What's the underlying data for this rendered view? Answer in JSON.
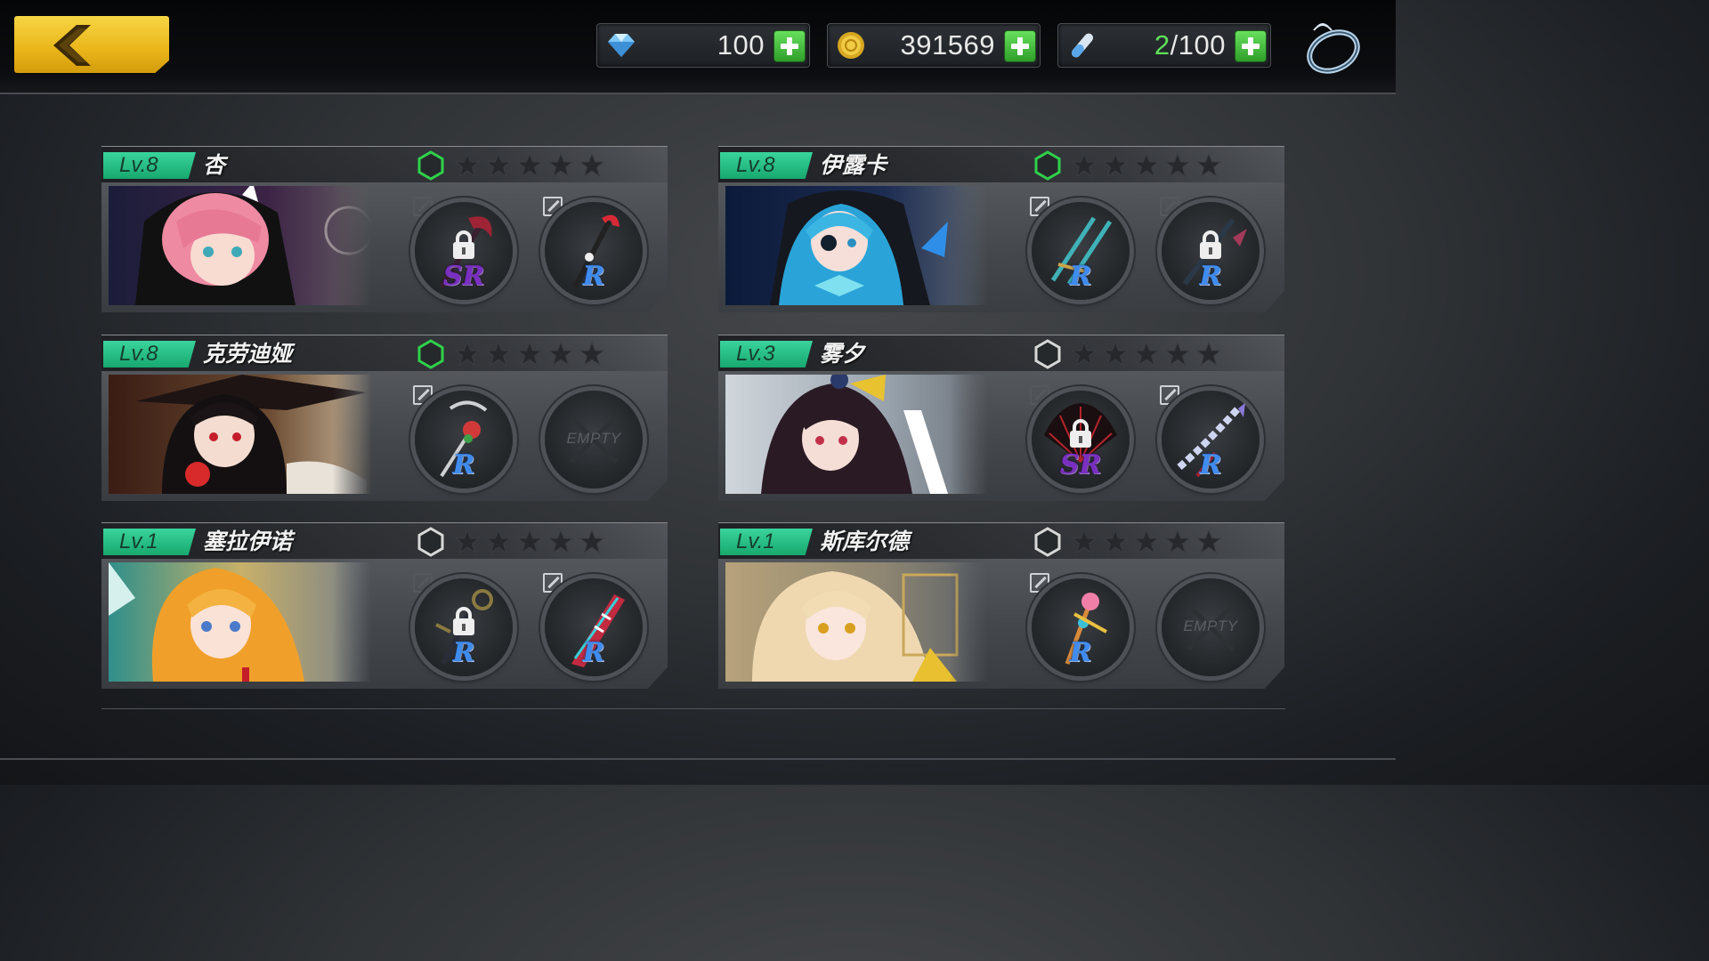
{
  "resources": {
    "gems": {
      "icon": "diamond-gem-icon",
      "value": "100"
    },
    "gold": {
      "icon": "gold-coin-icon",
      "value": "391569"
    },
    "stamina": {
      "icon": "test-tube-icon",
      "current": "2",
      "max": "/100"
    }
  },
  "colors": {
    "level_badge": "#22bf83",
    "hex_active": "#2fd14a",
    "hex_inactive": "#d8d8d8",
    "rarity_r": "#3f8cf0",
    "rarity_sr": "#7a2fc2",
    "back_button": "#f0c42a"
  },
  "characters": [
    {
      "level": "Lv.8",
      "name": "杏",
      "hex_active": true,
      "slots": [
        {
          "rarity": "SR",
          "locked": true,
          "weapon": "scythe-icon"
        },
        {
          "rarity": "R",
          "locked": false,
          "weapon": "staff-icon"
        }
      ]
    },
    {
      "level": "Lv.8",
      "name": "伊露卡",
      "hex_active": true,
      "slots": [
        {
          "rarity": "R",
          "locked": false,
          "weapon": "twin-swords-icon"
        },
        {
          "rarity": "R",
          "locked": true,
          "weapon": "spiked-spear-icon"
        }
      ]
    },
    {
      "level": "Lv.8",
      "name": "克劳迪娅",
      "hex_active": true,
      "slots": [
        {
          "rarity": "R",
          "locked": true,
          "weapon": "rose-staff-icon"
        },
        {
          "empty": "EMPTY"
        }
      ]
    },
    {
      "level": "Lv.3",
      "name": "雾夕",
      "hex_active": false,
      "slots": [
        {
          "rarity": "SR",
          "locked": true,
          "weapon": "feather-fan-icon"
        },
        {
          "rarity": "R",
          "locked": false,
          "weapon": "chain-blade-icon"
        }
      ]
    },
    {
      "level": "Lv.1",
      "name": "塞拉伊诺",
      "hex_active": false,
      "slots": [
        {
          "rarity": "R",
          "locked": true,
          "weapon": "key-staff-icon"
        },
        {
          "rarity": "R",
          "locked": false,
          "weapon": "striped-blade-icon"
        }
      ]
    },
    {
      "level": "Lv.1",
      "name": "斯库尔德",
      "hex_active": false,
      "slots": [
        {
          "rarity": "R",
          "locked": false,
          "weapon": "ornate-wand-icon"
        },
        {
          "empty": "EMPTY"
        }
      ]
    }
  ],
  "star_count": 5
}
